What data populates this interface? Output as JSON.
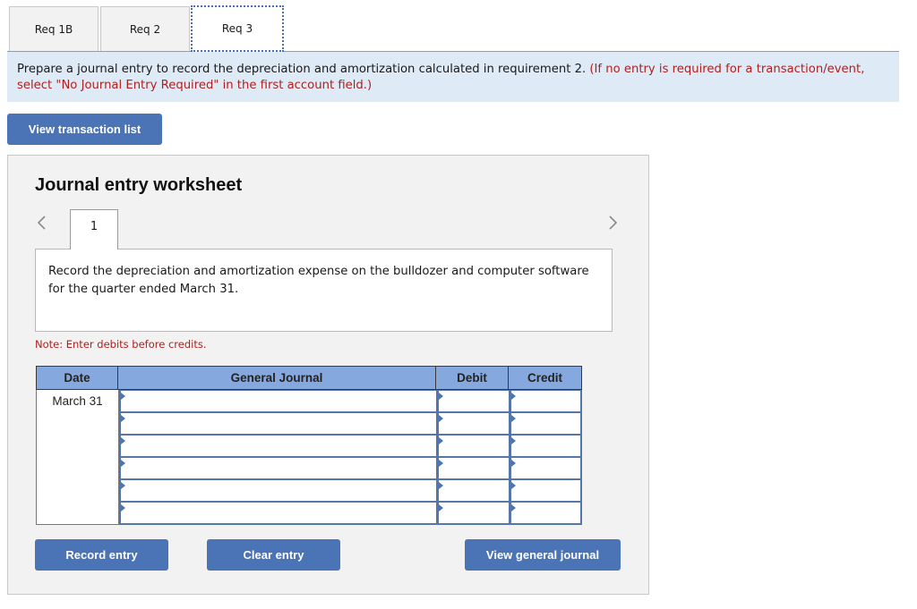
{
  "tabs": [
    {
      "label": "Req 1B",
      "active": false
    },
    {
      "label": "Req 2",
      "active": false
    },
    {
      "label": "Req 3",
      "active": true
    }
  ],
  "instructions": {
    "main": "Prepare a journal entry to record the depreciation and amortization calculated in requirement 2.",
    "hint": "(If no entry is required for a transaction/event, select \"No Journal Entry Required\" in the first account field.)"
  },
  "buttons": {
    "view_transaction_list": "View transaction list",
    "record_entry": "Record entry",
    "clear_entry": "Clear entry",
    "view_general_journal": "View general journal"
  },
  "worksheet": {
    "title": "Journal entry worksheet",
    "nav_prev": "<",
    "nav_next": ">",
    "entry_tab": "1",
    "description": "Record the depreciation and amortization expense on the bulldozer and computer software for the quarter ended March 31.",
    "note": "Note: Enter debits before credits."
  },
  "journal_table": {
    "headers": {
      "date": "Date",
      "general_journal": "General Journal",
      "debit": "Debit",
      "credit": "Credit"
    },
    "rows": [
      {
        "date": "March 31",
        "account": "",
        "debit": "",
        "credit": ""
      },
      {
        "date": "",
        "account": "",
        "debit": "",
        "credit": ""
      },
      {
        "date": "",
        "account": "",
        "debit": "",
        "credit": ""
      },
      {
        "date": "",
        "account": "",
        "debit": "",
        "credit": ""
      },
      {
        "date": "",
        "account": "",
        "debit": "",
        "credit": ""
      },
      {
        "date": "",
        "account": "",
        "debit": "",
        "credit": ""
      }
    ]
  },
  "colors": {
    "accent_button": "#4a74b5",
    "table_header": "#85a9df",
    "instruction_bg": "#dfeaf7",
    "hint_red": "#b0201e"
  }
}
